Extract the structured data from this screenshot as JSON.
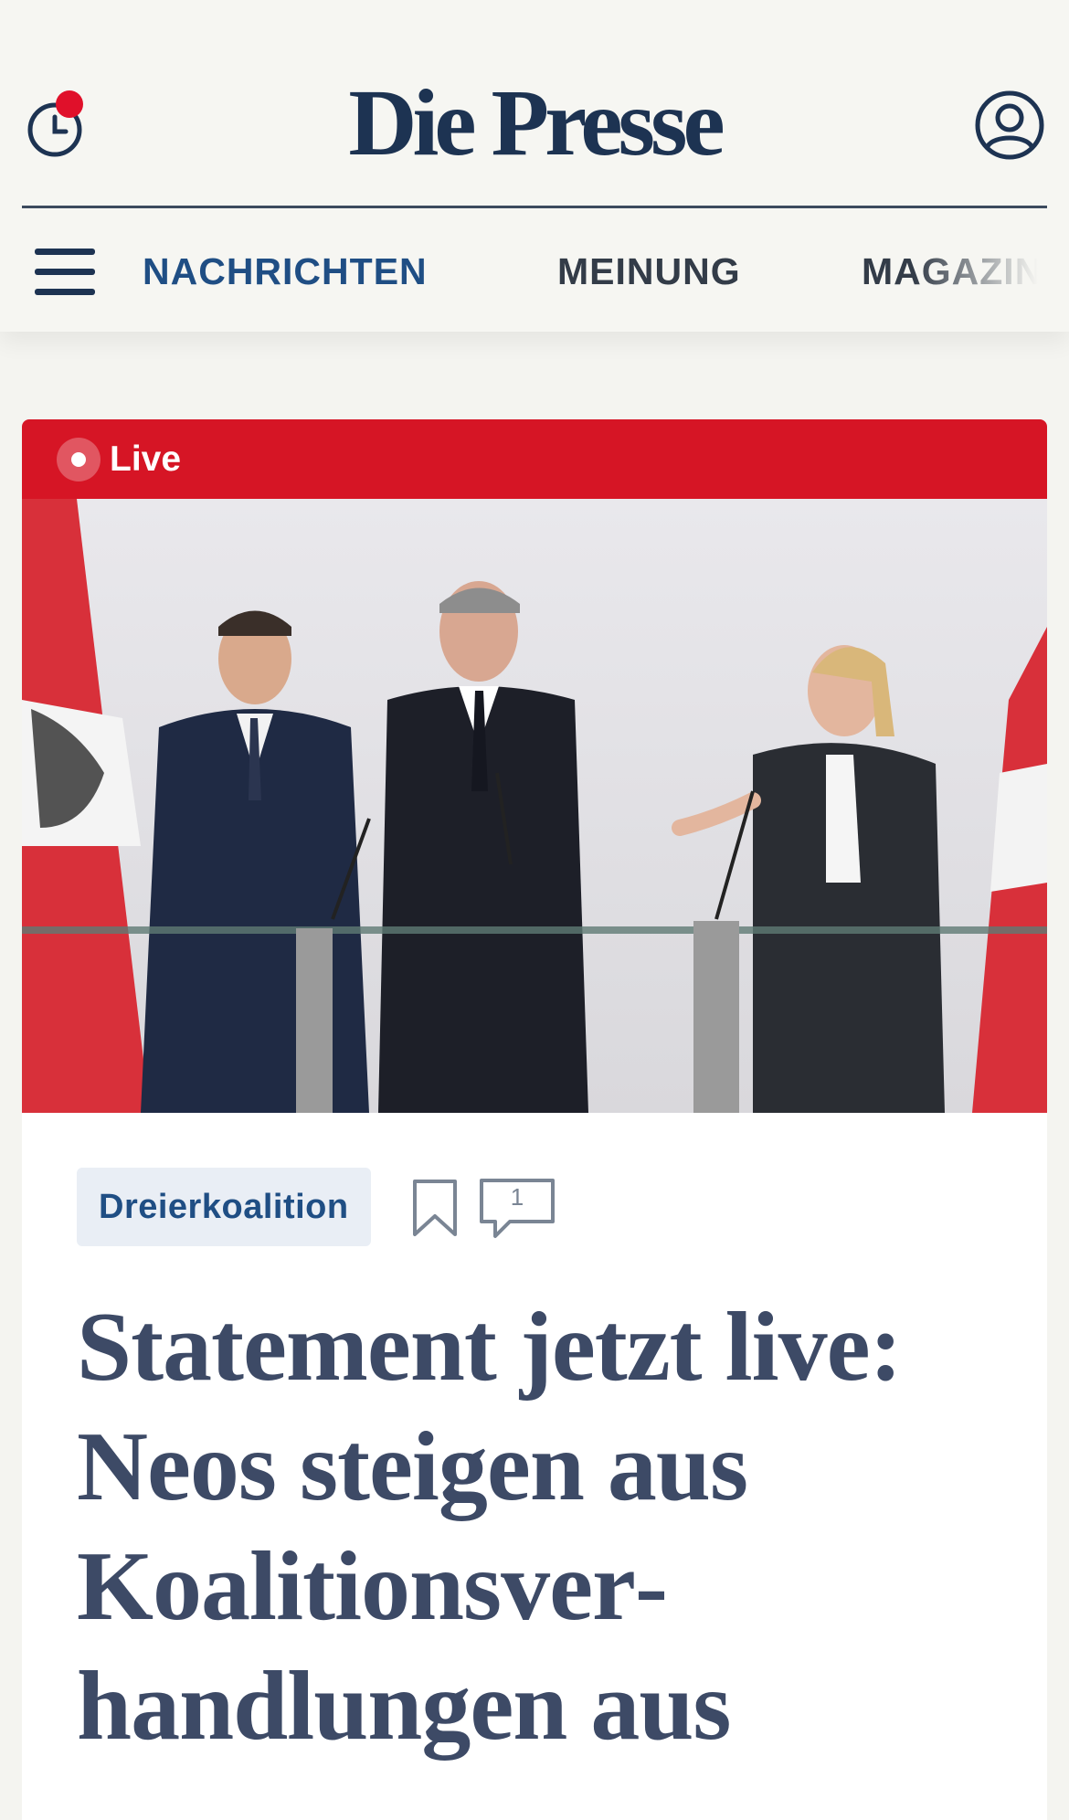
{
  "header": {
    "logo": "Die Presse",
    "history_icon": "clock-icon",
    "notification_color": "#e0102a",
    "user_icon": "user-icon"
  },
  "nav": {
    "menu_icon": "hamburger-menu-icon",
    "items": [
      {
        "label": "NACHRICHTEN",
        "active": true
      },
      {
        "label": "MEINUNG",
        "active": false
      },
      {
        "label": "MAGAZIN",
        "active": false
      }
    ]
  },
  "article": {
    "live_label": "Live",
    "live_color": "#d61525",
    "image_description_icon": "press-conference-photo",
    "tag": "Dreierkoalition",
    "bookmark_icon": "bookmark-icon",
    "comment_icon": "comment-icon",
    "comment_count": "1",
    "headline": "Statement jetzt live: Neos steigen aus Koalitionsver­handlungen aus"
  },
  "colors": {
    "brand": "#1d3352",
    "accent": "#1f4e84",
    "headline": "#3d4a66"
  }
}
